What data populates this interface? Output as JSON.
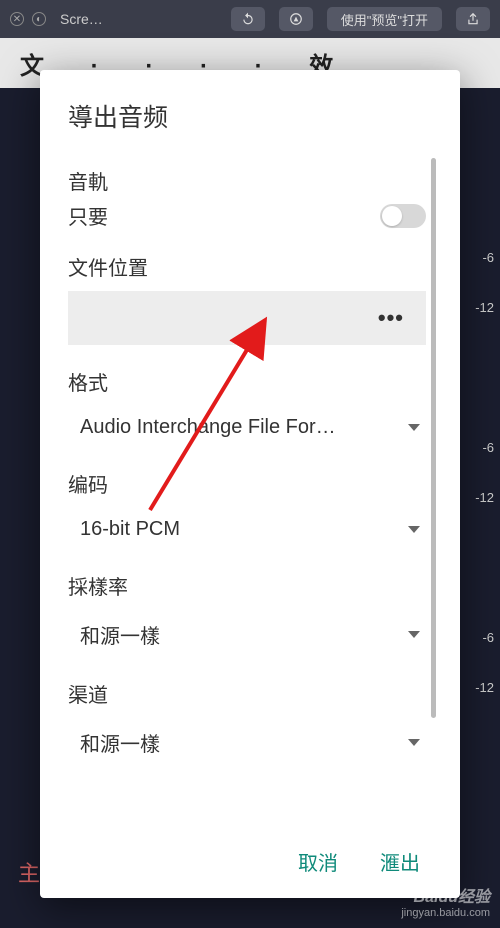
{
  "toolbar": {
    "title_truncated": "Scre…",
    "preview_button": "使用\"预览\"打开"
  },
  "bg": {
    "tabs_text": "文   ·   ·   ·   ·   效",
    "ruler": [
      "-6",
      "-12",
      "-6",
      "-12",
      "-6",
      "-12"
    ],
    "bottom_char": "主"
  },
  "dialog": {
    "title": "導出音频",
    "track_label": "音軌",
    "track_sub": "只要",
    "file_location_label": "文件位置",
    "file_browse_dots": "•••",
    "format_label": "格式",
    "format_value": "Audio Interchange File For…",
    "encoding_label": "编码",
    "encoding_value": "16-bit PCM",
    "samplerate_label": "採樣率",
    "samplerate_value": "和源一樣",
    "channels_label": "渠道",
    "channels_value": "和源一樣",
    "cancel": "取消",
    "export": "滙出"
  },
  "watermark": {
    "brand": "Baidu经验",
    "url": "jingyan.baidu.com"
  }
}
